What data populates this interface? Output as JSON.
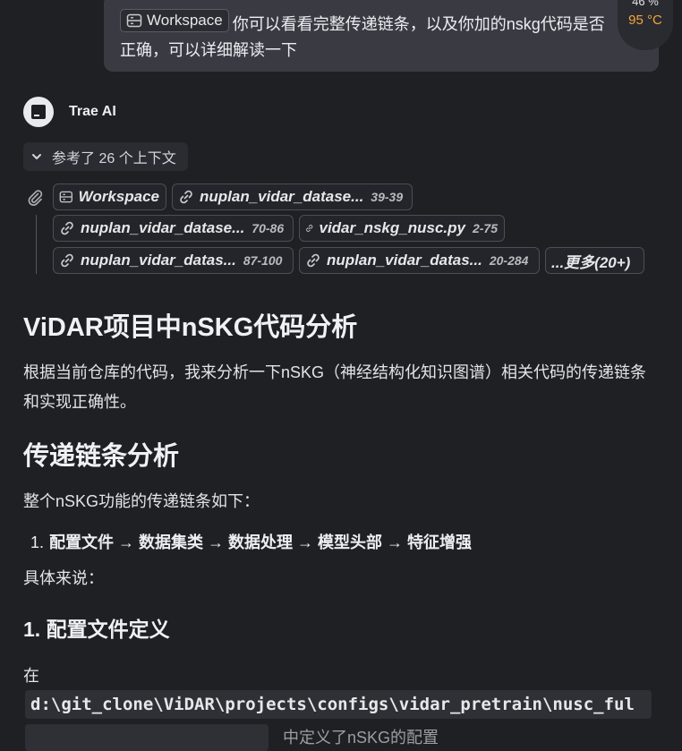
{
  "user_message": {
    "workspace_tag": "Workspace",
    "text": "你可以看看完整传递链条，以及你加的nskg代码是否正确，可以详细解读一下"
  },
  "temperature_widget": {
    "top": "46 %",
    "value": "95 °C",
    "value_color": "#f2a53b"
  },
  "assistant": {
    "name": "Trae AI",
    "avatar_icon": "trae-logo-icon"
  },
  "references": {
    "toggle_label": "参考了 26 个上下文",
    "chips": [
      {
        "icon": "folder-icon",
        "name": "Workspace",
        "lines": ""
      },
      {
        "icon": "link-icon",
        "name": "nuplan_vidar_datase...",
        "lines": "39-39"
      },
      {
        "icon": "link-icon",
        "name": "nuplan_vidar_datase...",
        "lines": "70-86"
      },
      {
        "icon": "link-icon",
        "name": "vidar_nskg_nusc.py",
        "lines": "2-75"
      },
      {
        "icon": "link-icon",
        "name": "nuplan_vidar_datas...",
        "lines": "87-100"
      },
      {
        "icon": "link-icon",
        "name": "nuplan_vidar_datas...",
        "lines": "20-284"
      }
    ],
    "more_label": "...更多(20+)"
  },
  "content": {
    "h1": "ViDAR项目中nSKG代码分析",
    "p1": "根据当前仓库的代码，我来分析一下nSKG（神经结构化知识图谱）相关代码的传递链条和实现正确性。",
    "h2": "传递链条分析",
    "p2": "整个nSKG功能的传递链条如下：",
    "list_item_number": "1.",
    "list_item": "配置文件 → 数据集类 → 数据处理 → 模型头部 → 特征增强",
    "p3": "具体来说：",
    "h3": "1. 配置文件定义",
    "p4": "在",
    "code_path": "d:\\git_clone\\ViDAR\\projects\\configs\\vidar_pretrain\\nusc_ful",
    "tail_text": "中定义了nSKG的配置"
  }
}
